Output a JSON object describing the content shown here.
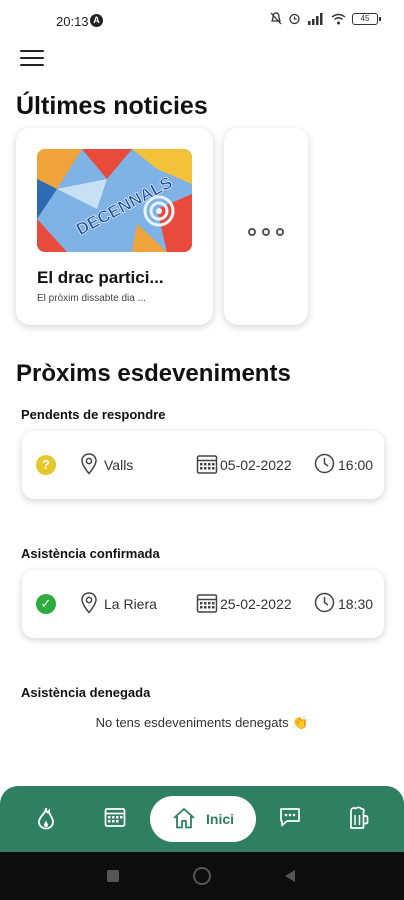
{
  "status_bar": {
    "time": "20:13",
    "indicator": "A",
    "battery": "45"
  },
  "news": {
    "title": "Últimes noticies",
    "cards": [
      {
        "title": "El drac partici...",
        "subtitle": "El pròxim dissabte dia ...",
        "image_text": "DECENNALS"
      }
    ]
  },
  "events": {
    "title": "Pròxims esdeveniments",
    "pending": {
      "label": "Pendents de respondre",
      "items": [
        {
          "status": "?",
          "location": "Valls",
          "date": "05-02-2022",
          "time": "16:00"
        }
      ]
    },
    "confirmed": {
      "label": "Asistència confirmada",
      "items": [
        {
          "status": "✓",
          "location": "La Riera",
          "date": "25-02-2022",
          "time": "18:30"
        }
      ]
    },
    "denied": {
      "label": "Asistència denegada",
      "empty_message": "No tens esdeveniments denegats 👏"
    }
  },
  "bottom_nav": {
    "home_label": "Inici",
    "items": [
      "flame-icon",
      "calendar-icon",
      "home-icon",
      "chat-icon",
      "beer-icon"
    ]
  },
  "colors": {
    "accent": "#2f7f62",
    "pending": "#e8c72b",
    "confirmed": "#2eac3f"
  }
}
